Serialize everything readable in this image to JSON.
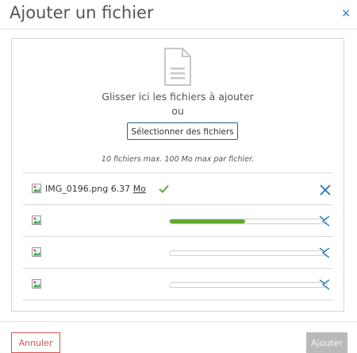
{
  "dialog": {
    "title": "Ajouter un fichier",
    "close_label": "×"
  },
  "dropzone": {
    "drop_text": "Glisser ici les fichiers à ajouter",
    "or_text": "ou",
    "select_button": "Sélectionner des fichiers",
    "limits_text": "10 fichiers max. 100 Mo max par fichier."
  },
  "files": [
    {
      "name": "IMG_0196.png",
      "size": "6.37",
      "unit": "Mo",
      "status": "done",
      "progress": 1.0
    },
    {
      "name": "",
      "status": "uploading",
      "progress": 0.48
    },
    {
      "name": "",
      "status": "pending",
      "progress": 0.0
    },
    {
      "name": "",
      "status": "pending",
      "progress": 0.0
    }
  ],
  "colors": {
    "accent": "#1f6fb2",
    "success": "#5fa831",
    "danger": "#d9534f",
    "disabled": "#b9b9b9"
  },
  "footer": {
    "cancel_label": "Annuler",
    "add_label": "Ajouter"
  }
}
